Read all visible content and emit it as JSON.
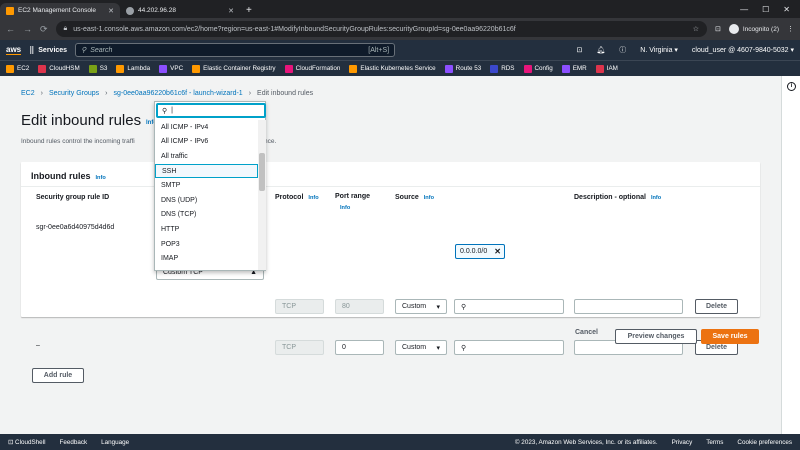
{
  "browser": {
    "tabs": [
      {
        "title": "EC2 Management Console",
        "fav_color": "#ff9900",
        "active": true
      },
      {
        "title": "44.202.96.28",
        "fav_color": "#9aa0a6",
        "active": false
      }
    ],
    "url": "us-east-1.console.aws.amazon.com/ec2/home?region=us-east-1#ModifyInboundSecurityGroupRules:securityGroupId=sg-0ee0aa96220b61c6f",
    "incognito_label": "Incognito (2)"
  },
  "aws_nav": {
    "logo": "aws",
    "services_label": "Services",
    "search_placeholder": "Search",
    "search_shortcut": "[Alt+S]",
    "region": "N. Virginia ▾",
    "account": "cloud_user @ 4607-9840-5032 ▾"
  },
  "favorites": [
    {
      "label": "EC2",
      "color": "#ff9900"
    },
    {
      "label": "CloudHSM",
      "color": "#dd344c"
    },
    {
      "label": "S3",
      "color": "#7aa116"
    },
    {
      "label": "Lambda",
      "color": "#ff9900"
    },
    {
      "label": "VPC",
      "color": "#8c4fff"
    },
    {
      "label": "Elastic Container Registry",
      "color": "#ff9900"
    },
    {
      "label": "CloudFormation",
      "color": "#e7157b"
    },
    {
      "label": "Elastic Kubernetes Service",
      "color": "#ff9900"
    },
    {
      "label": "Route 53",
      "color": "#8c4fff"
    },
    {
      "label": "RDS",
      "color": "#3b48cc"
    },
    {
      "label": "Config",
      "color": "#e7157b"
    },
    {
      "label": "EMR",
      "color": "#8c4fff"
    },
    {
      "label": "IAM",
      "color": "#dd344c"
    }
  ],
  "breadcrumb": [
    "EC2",
    "Security Groups",
    "sg-0ee0aa96220b61c6f - launch-wizard-1",
    "Edit inbound rules"
  ],
  "page": {
    "title": "Edit inbound rules",
    "title_info": "Info",
    "description_left": "Inbound rules control the incoming traffi",
    "description_right": "nce."
  },
  "panel": {
    "title": "Inbound rules",
    "info": "Info",
    "columns": {
      "rule_id": "Security group rule ID",
      "protocol": "Protocol",
      "port_range": "Port range",
      "source": "Source",
      "description": "Description - optional"
    },
    "rows": [
      {
        "rule_id": "sgr-0ee0a6d40975d4d6d",
        "protocol": "TCP",
        "port": "80",
        "source": "Custom",
        "cidr_chip": "0.0.0.0/0",
        "delete": "Delete"
      },
      {
        "rule_id": "–",
        "type": "Custom TCP",
        "protocol": "TCP",
        "port": "0",
        "source": "Custom",
        "delete": "Delete"
      }
    ],
    "add_rule": "Add rule"
  },
  "dropdown": {
    "search_value": "|",
    "items": [
      "All ICMP - IPv4",
      "All ICMP - IPv6",
      "All traffic",
      "SSH",
      "SMTP",
      "DNS (UDP)",
      "DNS (TCP)",
      "HTTP",
      "POP3",
      "IMAP"
    ],
    "highlighted": "SSH"
  },
  "actions": {
    "cancel": "Cancel",
    "preview": "Preview changes",
    "save": "Save rules"
  },
  "footer": {
    "cloudshell": "CloudShell",
    "feedback": "Feedback",
    "language": "Language",
    "copyright": "© 2023, Amazon Web Services, Inc. or its affiliates.",
    "privacy": "Privacy",
    "terms": "Terms",
    "cookie": "Cookie preferences"
  },
  "colors": {
    "accent": "#0073bb",
    "primary_button": "#ec7211",
    "nav_bg": "#232f3e"
  }
}
